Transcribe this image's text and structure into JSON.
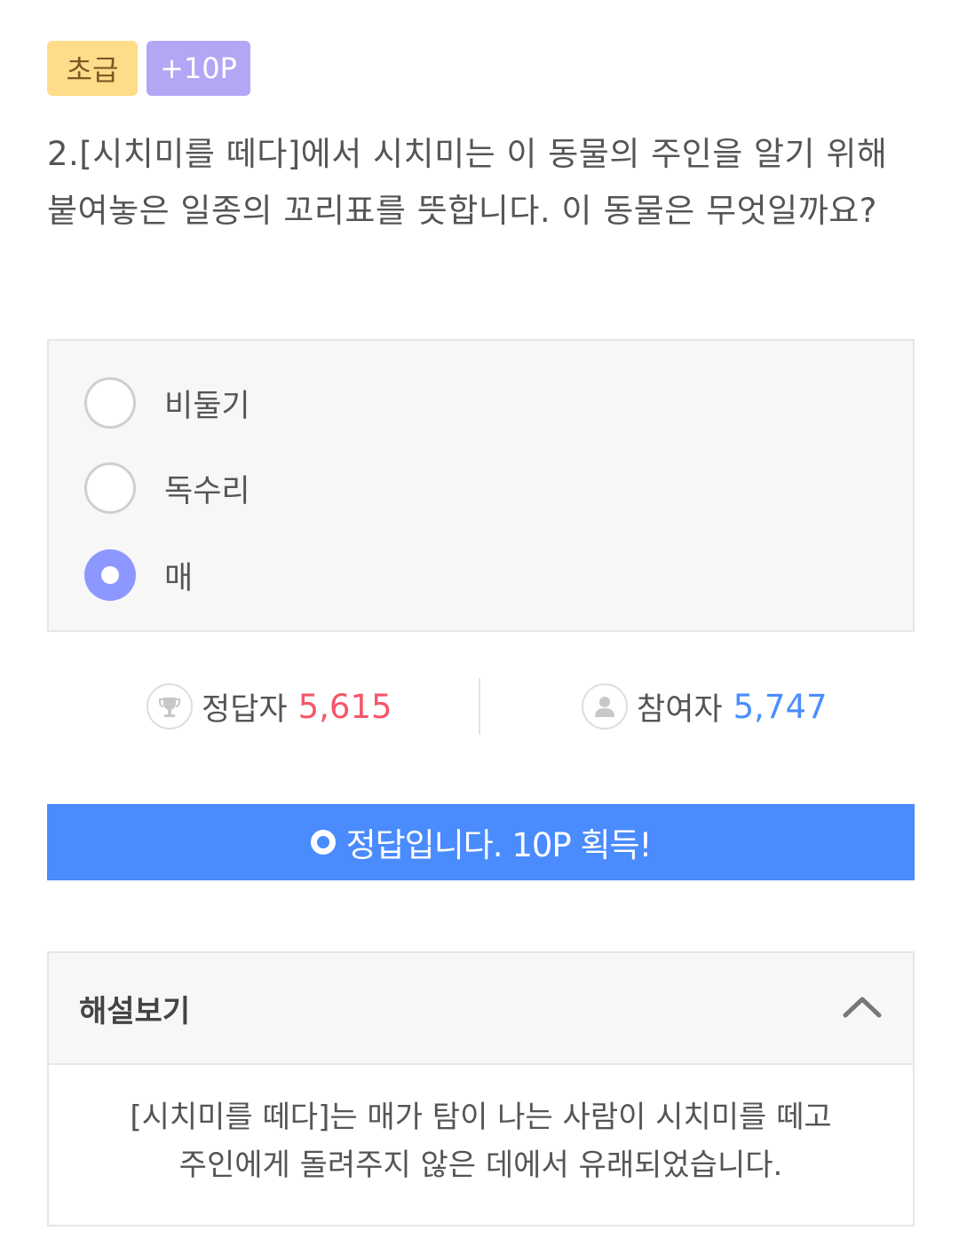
{
  "tags": {
    "level": "초급",
    "points": "+10P"
  },
  "question": {
    "text": "2.[시치미를 떼다]에서 시치미는 이 동물의 주인을 알기 위해 붙여놓은 일종의 꼬리표를 뜻합니다. 이 동물은 무엇일까요?"
  },
  "options": [
    {
      "label": "비둘기",
      "selected": false
    },
    {
      "label": "독수리",
      "selected": false
    },
    {
      "label": "매",
      "selected": true
    }
  ],
  "stats": {
    "correct_label": "정답자",
    "correct_count": "5,615",
    "participant_label": "참여자",
    "participant_count": "5,747"
  },
  "result": {
    "message": "정답입니다. 10P 획득!"
  },
  "explanation": {
    "title": "해설보기",
    "body": "[시치미를 떼다]는 매가 탐이 나는 사람이 시치미를 떼고 주인에게 돌려주지 않은 데에서 유래되었습니다."
  },
  "colors": {
    "level_tag": "#ffdc8a",
    "point_tag": "#b4a6f5",
    "radio_selected": "#8c97ff",
    "correct_count": "#f5566a",
    "participant_count": "#4a8eff",
    "result_button": "#4a8bfd"
  },
  "icons": {
    "correct": "trophy-icon",
    "participant": "user-icon",
    "result": "circle-o-icon",
    "collapse": "chevron-up-icon"
  }
}
